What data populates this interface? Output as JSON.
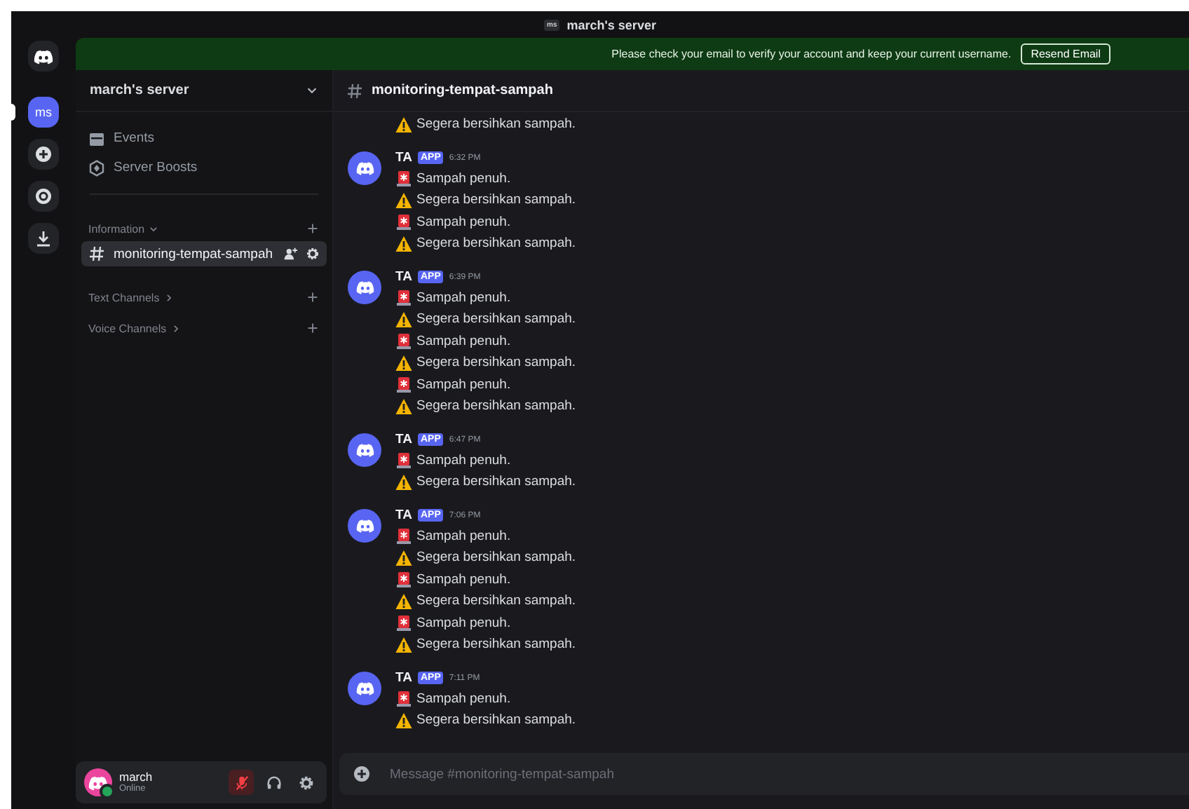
{
  "title_bar": {
    "server_icon": "ms",
    "title": "march's server"
  },
  "banner": {
    "text": "Please check your email to verify your account and keep your current username.",
    "button": "Resend Email"
  },
  "server_rail": {
    "items": [
      {
        "kind": "home",
        "selected": false
      },
      {
        "kind": "server",
        "label": "ms",
        "selected": true
      },
      {
        "kind": "add",
        "selected": false
      },
      {
        "kind": "discover",
        "selected": false
      },
      {
        "kind": "download",
        "selected": false
      }
    ]
  },
  "sidebar": {
    "server_name": "march's server",
    "items": [
      {
        "kind": "events",
        "label": "Events"
      },
      {
        "kind": "boosts",
        "label": "Server Boosts"
      }
    ],
    "categories": [
      {
        "name": "Information",
        "expanded": true,
        "channels": [
          {
            "name": "monitoring-tempat-sampah",
            "selected": true
          }
        ]
      },
      {
        "name": "Text Channels",
        "expanded": false
      },
      {
        "name": "Voice Channels",
        "expanded": false
      }
    ]
  },
  "user_panel": {
    "name": "march",
    "status": "Online",
    "mic_muted": true
  },
  "chat": {
    "channel": "monitoring-tempat-sampah",
    "messages": [
      {
        "lines": [
          {
            "kind": "warning",
            "text": "Segera bersihkan sampah."
          }
        ]
      },
      {
        "author": "TA",
        "badge": "APP",
        "time": "6:32 PM",
        "lines": [
          {
            "kind": "siren",
            "text": "Sampah penuh."
          },
          {
            "kind": "warning",
            "text": "Segera bersihkan sampah."
          },
          {
            "kind": "siren",
            "text": "Sampah penuh."
          },
          {
            "kind": "warning",
            "text": "Segera bersihkan sampah."
          }
        ]
      },
      {
        "author": "TA",
        "badge": "APP",
        "time": "6:39 PM",
        "lines": [
          {
            "kind": "siren",
            "text": "Sampah penuh."
          },
          {
            "kind": "warning",
            "text": "Segera bersihkan sampah."
          },
          {
            "kind": "siren",
            "text": "Sampah penuh."
          },
          {
            "kind": "warning",
            "text": "Segera bersihkan sampah."
          },
          {
            "kind": "siren",
            "text": "Sampah penuh."
          },
          {
            "kind": "warning",
            "text": "Segera bersihkan sampah."
          }
        ]
      },
      {
        "author": "TA",
        "badge": "APP",
        "time": "6:47 PM",
        "lines": [
          {
            "kind": "siren",
            "text": "Sampah penuh."
          },
          {
            "kind": "warning",
            "text": "Segera bersihkan sampah."
          }
        ]
      },
      {
        "author": "TA",
        "badge": "APP",
        "time": "7:06 PM",
        "lines": [
          {
            "kind": "siren",
            "text": "Sampah penuh."
          },
          {
            "kind": "warning",
            "text": "Segera bersihkan sampah."
          },
          {
            "kind": "siren",
            "text": "Sampah penuh."
          },
          {
            "kind": "warning",
            "text": "Segera bersihkan sampah."
          },
          {
            "kind": "siren",
            "text": "Sampah penuh."
          },
          {
            "kind": "warning",
            "text": "Segera bersihkan sampah."
          }
        ]
      },
      {
        "author": "TA",
        "badge": "APP",
        "time": "7:11 PM",
        "lines": [
          {
            "kind": "siren",
            "text": "Sampah penuh."
          },
          {
            "kind": "warning",
            "text": "Segera bersihkan sampah."
          }
        ]
      }
    ],
    "composer": {
      "placeholder": "Message #monitoring-tempat-sampah"
    }
  }
}
